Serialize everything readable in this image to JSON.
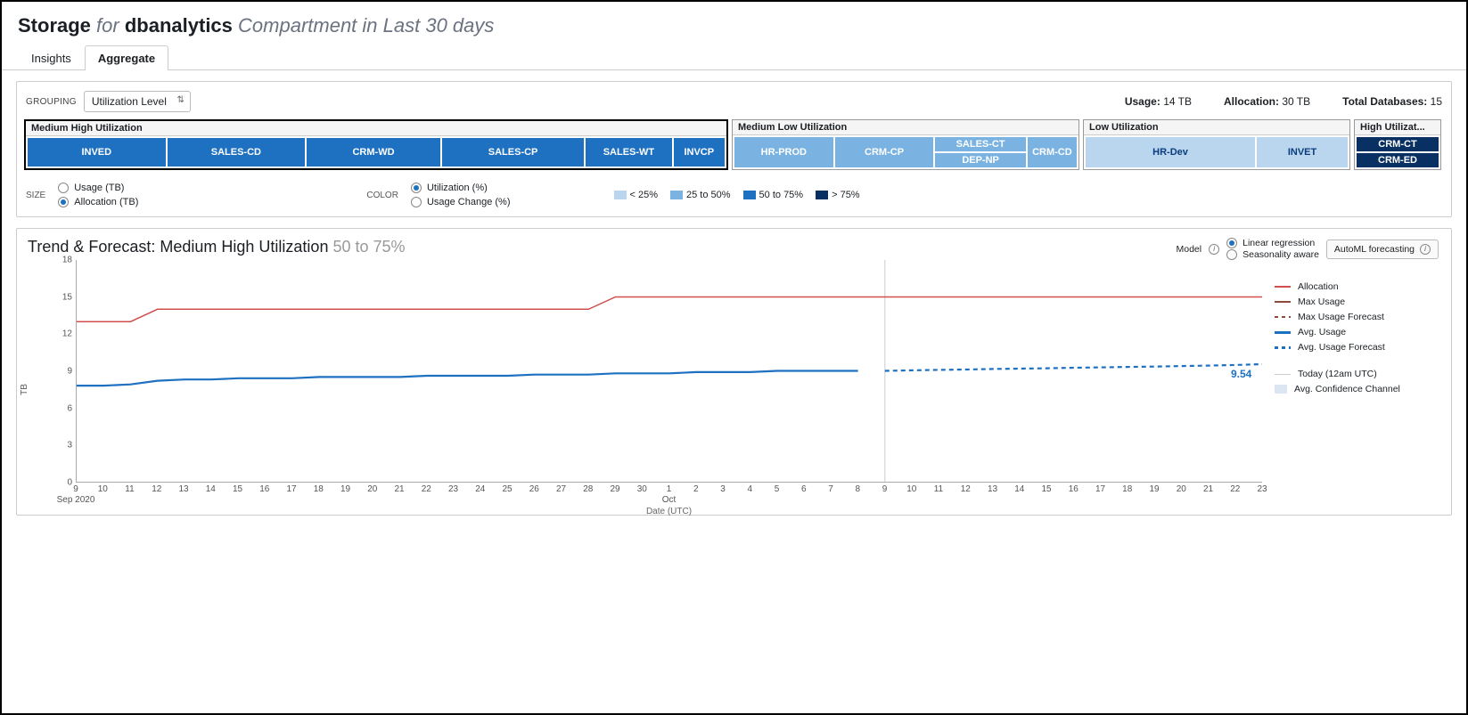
{
  "header": {
    "title_bold1": "Storage",
    "title_for": "for",
    "title_db": "dbanalytics",
    "title_rest": "Compartment in Last 30 days"
  },
  "tabs": {
    "insights": "Insights",
    "aggregate": "Aggregate"
  },
  "toolbar": {
    "grouping_label": "GROUPING",
    "grouping_value": "Utilization Level",
    "usage_label": "Usage:",
    "usage_value": "14 TB",
    "allocation_label": "Allocation:",
    "allocation_value": "30 TB",
    "total_label": "Total Databases:",
    "total_value": "15"
  },
  "treemap": {
    "groups": [
      {
        "name": "Medium High Utilization",
        "selected": true,
        "cells": [
          "INVED",
          "SALES-CD",
          "CRM-WD",
          "SALES-CP",
          "SALES-WT",
          "INVCP"
        ],
        "class": "med"
      },
      {
        "name": "Medium Low Utilization",
        "cells_main": [
          "HR-PROD",
          "CRM-CP"
        ],
        "cells_col": [
          "SALES-CT",
          "DEP-NP"
        ],
        "cells_narrow": [
          "CRM-CD"
        ],
        "class": "lightblue"
      },
      {
        "name": "Low Utilization",
        "cells": [
          "HR-Dev",
          "INVET"
        ],
        "class": "paleblue"
      },
      {
        "name": "High Utilizat...",
        "cells": [
          "CRM-CT",
          "CRM-ED"
        ],
        "class": "verydark"
      }
    ]
  },
  "legend": {
    "size_label": "SIZE",
    "size_opts": [
      {
        "label": "Usage (TB)",
        "sel": false
      },
      {
        "label": "Allocation (TB)",
        "sel": true
      }
    ],
    "color_label": "COLOR",
    "color_opts": [
      {
        "label": "Utilization (%)",
        "sel": true
      },
      {
        "label": "Usage Change (%)",
        "sel": false
      }
    ],
    "buckets": [
      {
        "label": "< 25%",
        "color": "#b9d6ee"
      },
      {
        "label": "25 to 50%",
        "color": "#7ab3e1"
      },
      {
        "label": "50 to 75%",
        "color": "#1e70c1"
      },
      {
        "label": "> 75%",
        "color": "#083062"
      }
    ]
  },
  "trend": {
    "title": "Trend & Forecast: Medium High Utilization",
    "title_grey": "50 to 75%",
    "model_label": "Model",
    "model_opts": [
      {
        "label": "Linear regression",
        "sel": true
      },
      {
        "label": "Seasonality aware",
        "sel": false
      }
    ],
    "automl_label": "AutoML forecasting",
    "forecast_end_value": "9.54",
    "ylabel": "TB",
    "xlabel": "Date (UTC)",
    "month1": "Sep 2020",
    "month2": "Oct",
    "legend": [
      "Allocation",
      "Max Usage",
      "Max Usage Forecast",
      "Avg. Usage",
      "Avg. Usage Forecast",
      "Today (12am UTC)",
      "Avg. Confidence Channel"
    ]
  },
  "chart_data": {
    "type": "line",
    "title": "Trend & Forecast: Medium High Utilization 50 to 75%",
    "xlabel": "Date (UTC)",
    "ylabel": "TB",
    "ylim": [
      0,
      18
    ],
    "x": [
      "Sep 9",
      "Sep 10",
      "Sep 11",
      "Sep 12",
      "Sep 13",
      "Sep 14",
      "Sep 15",
      "Sep 16",
      "Sep 17",
      "Sep 18",
      "Sep 19",
      "Sep 20",
      "Sep 21",
      "Sep 22",
      "Sep 23",
      "Sep 24",
      "Sep 25",
      "Sep 26",
      "Sep 27",
      "Sep 28",
      "Sep 29",
      "Sep 30",
      "Oct 1",
      "Oct 2",
      "Oct 3",
      "Oct 4",
      "Oct 5",
      "Oct 6",
      "Oct 7",
      "Oct 8",
      "Oct 9",
      "Oct 10",
      "Oct 11",
      "Oct 12",
      "Oct 13",
      "Oct 14",
      "Oct 15",
      "Oct 16",
      "Oct 17",
      "Oct 18",
      "Oct 19",
      "Oct 20",
      "Oct 21",
      "Oct 22",
      "Oct 23"
    ],
    "today_index": 30,
    "series": [
      {
        "name": "Allocation",
        "values": [
          13,
          13,
          13,
          14,
          14,
          14,
          14,
          14,
          14,
          14,
          14,
          14,
          14,
          14,
          14,
          14,
          14,
          14,
          14,
          14,
          15,
          15,
          15,
          15,
          15,
          15,
          15,
          15,
          15,
          15,
          15,
          15,
          15,
          15,
          15,
          15,
          15,
          15,
          15,
          15,
          15,
          15,
          15,
          15,
          15
        ]
      },
      {
        "name": "Avg. Usage",
        "values": [
          7.8,
          7.8,
          7.9,
          8.2,
          8.3,
          8.3,
          8.4,
          8.4,
          8.4,
          8.5,
          8.5,
          8.5,
          8.5,
          8.6,
          8.6,
          8.6,
          8.6,
          8.7,
          8.7,
          8.7,
          8.8,
          8.8,
          8.8,
          8.9,
          8.9,
          8.9,
          9.0,
          9.0,
          9.0,
          9.0,
          null,
          null,
          null,
          null,
          null,
          null,
          null,
          null,
          null,
          null,
          null,
          null,
          null,
          null,
          null
        ]
      },
      {
        "name": "Avg. Usage Forecast",
        "values": [
          null,
          null,
          null,
          null,
          null,
          null,
          null,
          null,
          null,
          null,
          null,
          null,
          null,
          null,
          null,
          null,
          null,
          null,
          null,
          null,
          null,
          null,
          null,
          null,
          null,
          null,
          null,
          null,
          null,
          null,
          9.0,
          9.04,
          9.08,
          9.11,
          9.15,
          9.18,
          9.21,
          9.25,
          9.28,
          9.32,
          9.35,
          9.39,
          9.43,
          9.48,
          9.54
        ]
      }
    ]
  }
}
